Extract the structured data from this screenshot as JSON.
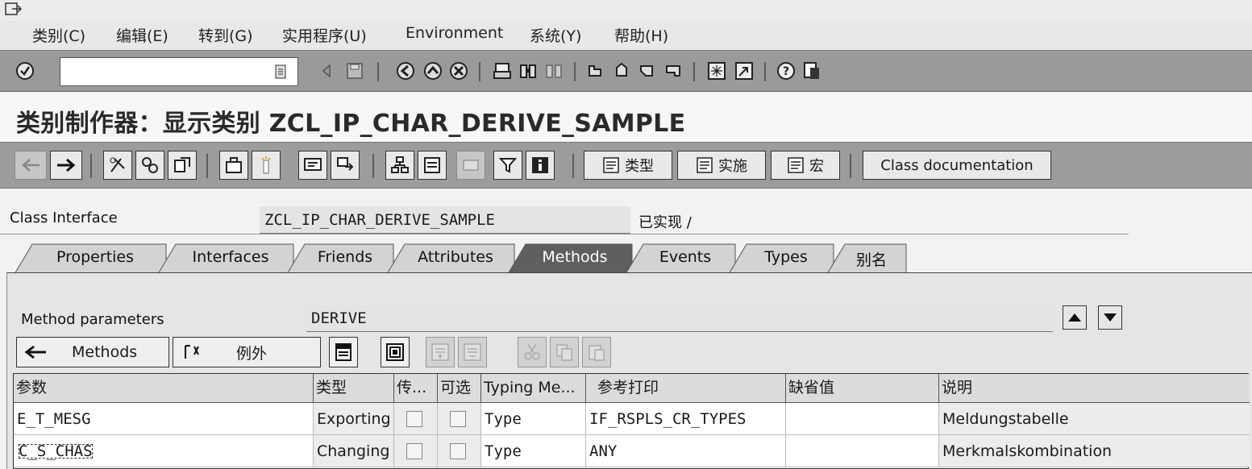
{
  "menu": {
    "items": [
      "类别(C)",
      "编辑(E)",
      "转到(G)",
      "实用程序(U)",
      "Environment",
      "系统(Y)",
      "帮助(H)"
    ]
  },
  "system_toolbar": {
    "command_field_value": "",
    "icons": [
      "enter-icon",
      "save-icon",
      "back-icon",
      "exit-icon",
      "cancel-icon",
      "print-icon",
      "find-icon",
      "find-next-icon",
      "first-page-icon",
      "prev-page-icon",
      "next-page-icon",
      "last-page-icon",
      "new-session-icon",
      "shortcut-icon",
      "help-icon",
      "layout-menu-icon"
    ]
  },
  "title": "类别制作器：显示类别 ZCL_IP_CHAR_DERIVE_SAMPLE",
  "app_toolbar": {
    "btn_type": "类型",
    "btn_impl": "实施",
    "btn_macro": "宏",
    "btn_doc": "Class documentation"
  },
  "header": {
    "class_interface_label": "Class Interface",
    "class_interface_value": "ZCL_IP_CHAR_DERIVE_SAMPLE",
    "status": "已实现 /"
  },
  "tabs": [
    {
      "label": "Properties",
      "active": false
    },
    {
      "label": "Interfaces",
      "active": false
    },
    {
      "label": "Friends",
      "active": false
    },
    {
      "label": "Attributes",
      "active": false
    },
    {
      "label": "Methods",
      "active": true
    },
    {
      "label": "Events",
      "active": false
    },
    {
      "label": "Types",
      "active": false
    },
    {
      "label": "别名",
      "active": false
    }
  ],
  "method_params": {
    "label": "Method parameters",
    "value": "DERIVE"
  },
  "sub_toolbar": {
    "methods_label": "Methods",
    "exceptions_label": "例外"
  },
  "table": {
    "columns": [
      "参数",
      "类型",
      "传...",
      "可选",
      "Typing Me...",
      "参考打印",
      "缺省值",
      "说明"
    ],
    "rows": [
      {
        "param": "E_T_MESG",
        "type": "Exporting",
        "pass_by_value": false,
        "optional": false,
        "typing": "Type",
        "ref_type": "IF_RSPLS_CR_TYPES",
        "default": "",
        "desc": "Meldungstabelle"
      },
      {
        "param": "C_S_CHAS",
        "type": "Changing",
        "pass_by_value": false,
        "optional": false,
        "typing": "Type",
        "ref_type": "ANY",
        "default": "",
        "desc": "Merkmalskombination"
      }
    ]
  }
}
